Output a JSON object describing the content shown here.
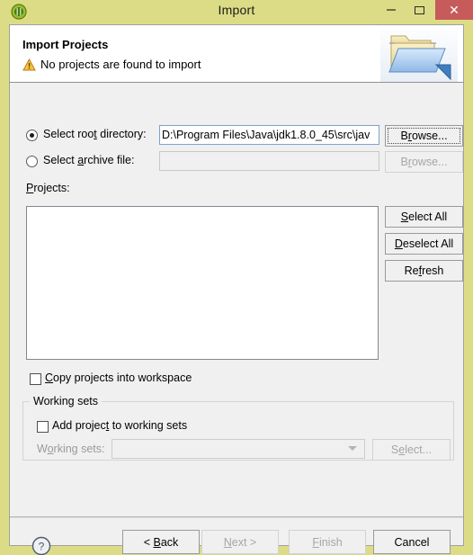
{
  "window": {
    "title": "Import",
    "app_icon": "eclipse-icon",
    "controls": {
      "minimize": "minimize-icon",
      "maximize": "maximize-icon",
      "close": "close-icon"
    }
  },
  "banner": {
    "title": "Import Projects",
    "message": "No projects are found to import",
    "status_icon": "warning-icon",
    "decor_icon": "open-folder-icon"
  },
  "source": {
    "root_radio_label_pre": "Select roo",
    "root_radio_mnemonic": "t",
    "root_radio_label_post": " directory:",
    "root_selected": true,
    "root_value": "D:\\Program Files\\Java\\jdk1.8.0_45\\src\\jav",
    "root_browse_label_pre": "B",
    "root_browse_mnemonic": "r",
    "root_browse_label_post": "owse...",
    "archive_radio_label_pre": "Select ",
    "archive_radio_mnemonic": "a",
    "archive_radio_label_post": "rchive file:",
    "archive_selected": false,
    "archive_value": "",
    "archive_browse_label_pre": "B",
    "archive_browse_mnemonic": "r",
    "archive_browse_label_post": "owse..."
  },
  "projects": {
    "label_mnemonic": "P",
    "label_post": "rojects:",
    "items": [],
    "select_all_mnemonic": "S",
    "select_all_post": "elect All",
    "deselect_all_mnemonic": "D",
    "deselect_all_post": "eselect All",
    "refresh_pre": "Re",
    "refresh_mnemonic": "f",
    "refresh_post": "resh"
  },
  "options": {
    "copy_checkbox_mnemonic": "C",
    "copy_checkbox_post": "opy projects into workspace",
    "copy_checked": false
  },
  "working_sets": {
    "group_label": "Working sets",
    "add_checkbox_pre": "Add projec",
    "add_checkbox_mnemonic": "t",
    "add_checkbox_post": " to working sets",
    "add_checked": false,
    "combo_label_pre": "W",
    "combo_label_mnemonic": "o",
    "combo_label_post": "rking sets:",
    "combo_value": "",
    "select_pre": "S",
    "select_mnemonic": "e",
    "select_post": "lect...",
    "enabled": false
  },
  "footer": {
    "help_icon": "help-icon",
    "back_pre": "< ",
    "back_mnemonic": "B",
    "back_post": "ack",
    "back_enabled": true,
    "next_mnemonic": "N",
    "next_post": "ext >",
    "next_enabled": false,
    "finish_mnemonic": "F",
    "finish_post": "inish",
    "finish_enabled": false,
    "cancel_label": "Cancel",
    "cancel_enabled": true
  },
  "colors": {
    "frame": "#dcdc87",
    "dialog_bg": "#f0f0f0",
    "banner_bg": "#ffffff",
    "close_btn": "#c75b5b",
    "field_border_focus": "#7da2ce"
  }
}
